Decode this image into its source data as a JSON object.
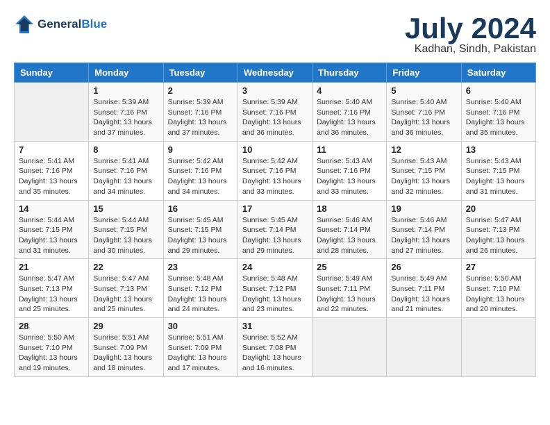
{
  "header": {
    "logo_line1": "General",
    "logo_line2": "Blue",
    "month": "July 2024",
    "location": "Kadhan, Sindh, Pakistan"
  },
  "weekdays": [
    "Sunday",
    "Monday",
    "Tuesday",
    "Wednesday",
    "Thursday",
    "Friday",
    "Saturday"
  ],
  "weeks": [
    [
      {
        "day": "",
        "content": ""
      },
      {
        "day": "1",
        "content": "Sunrise: 5:39 AM\nSunset: 7:16 PM\nDaylight: 13 hours\nand 37 minutes."
      },
      {
        "day": "2",
        "content": "Sunrise: 5:39 AM\nSunset: 7:16 PM\nDaylight: 13 hours\nand 37 minutes."
      },
      {
        "day": "3",
        "content": "Sunrise: 5:39 AM\nSunset: 7:16 PM\nDaylight: 13 hours\nand 36 minutes."
      },
      {
        "day": "4",
        "content": "Sunrise: 5:40 AM\nSunset: 7:16 PM\nDaylight: 13 hours\nand 36 minutes."
      },
      {
        "day": "5",
        "content": "Sunrise: 5:40 AM\nSunset: 7:16 PM\nDaylight: 13 hours\nand 36 minutes."
      },
      {
        "day": "6",
        "content": "Sunrise: 5:40 AM\nSunset: 7:16 PM\nDaylight: 13 hours\nand 35 minutes."
      }
    ],
    [
      {
        "day": "7",
        "content": "Sunrise: 5:41 AM\nSunset: 7:16 PM\nDaylight: 13 hours\nand 35 minutes."
      },
      {
        "day": "8",
        "content": "Sunrise: 5:41 AM\nSunset: 7:16 PM\nDaylight: 13 hours\nand 34 minutes."
      },
      {
        "day": "9",
        "content": "Sunrise: 5:42 AM\nSunset: 7:16 PM\nDaylight: 13 hours\nand 34 minutes."
      },
      {
        "day": "10",
        "content": "Sunrise: 5:42 AM\nSunset: 7:16 PM\nDaylight: 13 hours\nand 33 minutes."
      },
      {
        "day": "11",
        "content": "Sunrise: 5:43 AM\nSunset: 7:16 PM\nDaylight: 13 hours\nand 33 minutes."
      },
      {
        "day": "12",
        "content": "Sunrise: 5:43 AM\nSunset: 7:15 PM\nDaylight: 13 hours\nand 32 minutes."
      },
      {
        "day": "13",
        "content": "Sunrise: 5:43 AM\nSunset: 7:15 PM\nDaylight: 13 hours\nand 31 minutes."
      }
    ],
    [
      {
        "day": "14",
        "content": "Sunrise: 5:44 AM\nSunset: 7:15 PM\nDaylight: 13 hours\nand 31 minutes."
      },
      {
        "day": "15",
        "content": "Sunrise: 5:44 AM\nSunset: 7:15 PM\nDaylight: 13 hours\nand 30 minutes."
      },
      {
        "day": "16",
        "content": "Sunrise: 5:45 AM\nSunset: 7:15 PM\nDaylight: 13 hours\nand 29 minutes."
      },
      {
        "day": "17",
        "content": "Sunrise: 5:45 AM\nSunset: 7:14 PM\nDaylight: 13 hours\nand 29 minutes."
      },
      {
        "day": "18",
        "content": "Sunrise: 5:46 AM\nSunset: 7:14 PM\nDaylight: 13 hours\nand 28 minutes."
      },
      {
        "day": "19",
        "content": "Sunrise: 5:46 AM\nSunset: 7:14 PM\nDaylight: 13 hours\nand 27 minutes."
      },
      {
        "day": "20",
        "content": "Sunrise: 5:47 AM\nSunset: 7:13 PM\nDaylight: 13 hours\nand 26 minutes."
      }
    ],
    [
      {
        "day": "21",
        "content": "Sunrise: 5:47 AM\nSunset: 7:13 PM\nDaylight: 13 hours\nand 25 minutes."
      },
      {
        "day": "22",
        "content": "Sunrise: 5:47 AM\nSunset: 7:13 PM\nDaylight: 13 hours\nand 25 minutes."
      },
      {
        "day": "23",
        "content": "Sunrise: 5:48 AM\nSunset: 7:12 PM\nDaylight: 13 hours\nand 24 minutes."
      },
      {
        "day": "24",
        "content": "Sunrise: 5:48 AM\nSunset: 7:12 PM\nDaylight: 13 hours\nand 23 minutes."
      },
      {
        "day": "25",
        "content": "Sunrise: 5:49 AM\nSunset: 7:11 PM\nDaylight: 13 hours\nand 22 minutes."
      },
      {
        "day": "26",
        "content": "Sunrise: 5:49 AM\nSunset: 7:11 PM\nDaylight: 13 hours\nand 21 minutes."
      },
      {
        "day": "27",
        "content": "Sunrise: 5:50 AM\nSunset: 7:10 PM\nDaylight: 13 hours\nand 20 minutes."
      }
    ],
    [
      {
        "day": "28",
        "content": "Sunrise: 5:50 AM\nSunset: 7:10 PM\nDaylight: 13 hours\nand 19 minutes."
      },
      {
        "day": "29",
        "content": "Sunrise: 5:51 AM\nSunset: 7:09 PM\nDaylight: 13 hours\nand 18 minutes."
      },
      {
        "day": "30",
        "content": "Sunrise: 5:51 AM\nSunset: 7:09 PM\nDaylight: 13 hours\nand 17 minutes."
      },
      {
        "day": "31",
        "content": "Sunrise: 5:52 AM\nSunset: 7:08 PM\nDaylight: 13 hours\nand 16 minutes."
      },
      {
        "day": "",
        "content": ""
      },
      {
        "day": "",
        "content": ""
      },
      {
        "day": "",
        "content": ""
      }
    ]
  ]
}
